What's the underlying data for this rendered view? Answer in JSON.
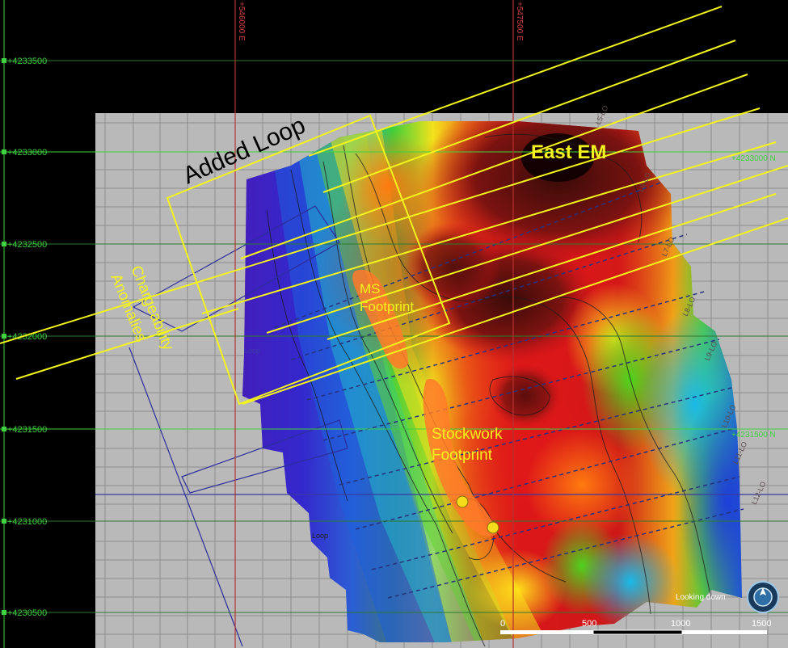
{
  "northing_labels": [
    "+4233500",
    "+4233000",
    "+4232500",
    "+4232000",
    "+4231500",
    "+4231000",
    "+4230500"
  ],
  "northing_right_labels": [
    "+4233000 N",
    "+4231500 N"
  ],
  "easting_labels": [
    "+546000 E",
    "+547500 E"
  ],
  "annotations": {
    "added_loop": "Added Loop",
    "east_em": "East EM",
    "ms_footprint_1": "MS",
    "ms_footprint_2": "Footprint",
    "stockwork_1": "Stockwork",
    "stockwork_2": "Footprint",
    "chargeability_1": "Chargeability",
    "chargeability_2": "Anomalies"
  },
  "line_labels": [
    "L5-LO",
    "L6-LO",
    "L7-LO",
    "L8-LO",
    "L9-LO",
    "L10-LO",
    "L11-LO",
    "L12-LO"
  ],
  "loop_labels": [
    "Loop",
    "Loop"
  ],
  "scale_bar": {
    "ticks": [
      "0",
      "500",
      "1000",
      "1500"
    ]
  },
  "view_label": "Looking down",
  "colors": {
    "grid_green": "#3fd13f",
    "grid_red": "#b43232",
    "yellow": "#f3f31e",
    "background_grey": "#b9b9b9",
    "navy_lines": "#2d2d9c"
  }
}
